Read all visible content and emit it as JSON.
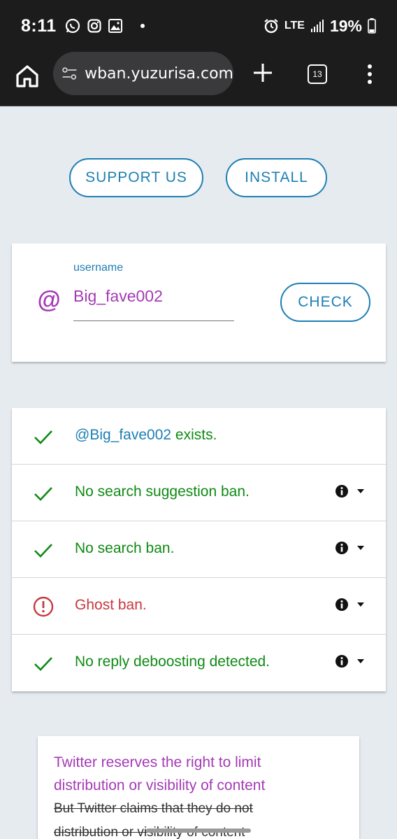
{
  "status_bar": {
    "time": "8:11",
    "network": "LTE",
    "battery": "19%",
    "icons": [
      "whatsapp-icon",
      "instagram-icon",
      "gallery-icon",
      "dot-icon",
      "alarm-icon",
      "signal-icon",
      "battery-icon"
    ]
  },
  "browser": {
    "url": "wban.yuzurisa.com",
    "tab_count": "13"
  },
  "actions": {
    "support_label": "SUPPORT US",
    "install_label": "INSTALL"
  },
  "search": {
    "prefix": "@",
    "label": "username",
    "value": "Big_fave002",
    "check_label": "CHECK"
  },
  "results": [
    {
      "status": "ok",
      "handle": "@Big_fave002",
      "text": " exists.",
      "has_info": false
    },
    {
      "status": "ok",
      "text": "No search suggestion ban.",
      "has_info": true
    },
    {
      "status": "ok",
      "text": "No search ban.",
      "has_info": true
    },
    {
      "status": "bad",
      "text": "Ghost ban.",
      "has_info": true
    },
    {
      "status": "ok",
      "text": "No reply deboosting detected.",
      "has_info": true
    }
  ],
  "notice": {
    "line1": "Twitter reserves the right to limit",
    "line2": "distribution or visibility of content",
    "strike1": "But Twitter claims that they do not",
    "strike2": "distribution or visibility of content"
  },
  "colors": {
    "accent": "#1d7fb3",
    "purple": "#a43ab5",
    "ok": "#0f8a14",
    "bad": "#c7393f",
    "background": "#e6ebef"
  }
}
